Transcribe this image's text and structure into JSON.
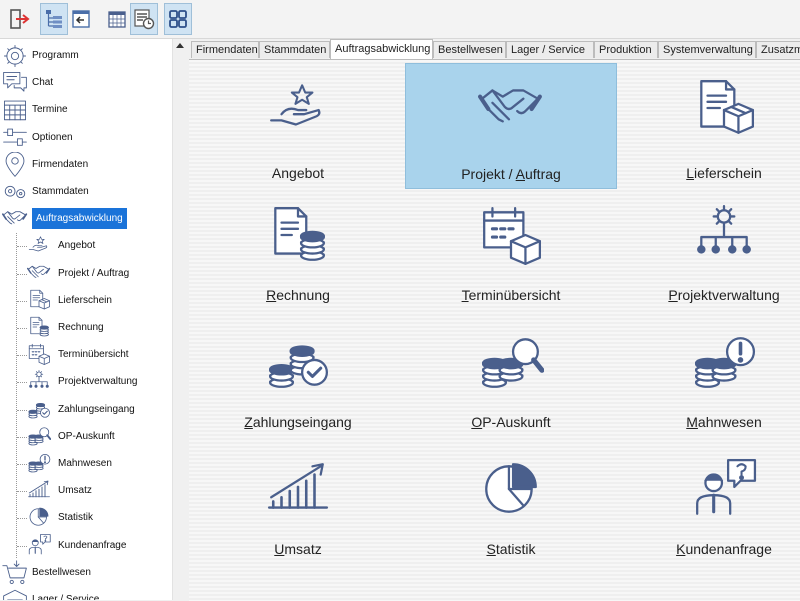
{
  "toolbar": {
    "buttons": [
      {
        "name": "logout-button",
        "icon": "exit-door-icon",
        "active": false
      },
      {
        "name": "tree-view-button",
        "icon": "tree-icon",
        "active": true
      },
      {
        "name": "back-panel-button",
        "icon": "panel-back-icon",
        "active": false
      },
      {
        "name": "calendar-button",
        "icon": "calendar-icon",
        "active": false
      },
      {
        "name": "calendar-clock-button",
        "icon": "calendar-clock-icon",
        "active": true
      },
      {
        "name": "grid-view-button",
        "icon": "grid-icon",
        "active": true
      }
    ]
  },
  "sidebar": {
    "items": [
      {
        "label": "Programm",
        "icon": "gear-badge-icon"
      },
      {
        "label": "Chat",
        "icon": "chat-icon"
      },
      {
        "label": "Termine",
        "icon": "calendar-icon"
      },
      {
        "label": "Optionen",
        "icon": "options-icon"
      },
      {
        "label": "Firmendaten",
        "icon": "location-pin-icon"
      },
      {
        "label": "Stammdaten",
        "icon": "gears-icon"
      },
      {
        "label": "Auftragsabwicklung",
        "icon": "handshake-icon",
        "selected": true
      },
      {
        "label": "Angebot",
        "icon": "hand-star-icon",
        "child": true
      },
      {
        "label": "Projekt / Auftrag",
        "icon": "handshake-icon",
        "child": true
      },
      {
        "label": "Lieferschein",
        "icon": "document-box-icon",
        "child": true
      },
      {
        "label": "Rechnung",
        "icon": "document-coins-icon",
        "child": true
      },
      {
        "label": "Terminübersicht",
        "icon": "calendar-box-icon",
        "child": true
      },
      {
        "label": "Projektverwaltung",
        "icon": "org-chart-gear-icon",
        "child": true
      },
      {
        "label": "Zahlungseingang",
        "icon": "coins-check-icon",
        "child": true
      },
      {
        "label": "OP-Auskunft",
        "icon": "coins-search-icon",
        "child": true
      },
      {
        "label": "Mahnwesen",
        "icon": "coins-alert-icon",
        "child": true
      },
      {
        "label": "Umsatz",
        "icon": "growth-chart-icon",
        "child": true
      },
      {
        "label": "Statistik",
        "icon": "pie-chart-icon",
        "child": true
      },
      {
        "label": "Kundenanfrage",
        "icon": "person-question-icon",
        "child": true
      },
      {
        "label": "Bestellwesen",
        "icon": "cart-icon"
      },
      {
        "label": "Lager / Service",
        "icon": "warehouse-icon"
      }
    ]
  },
  "tabs": [
    "Firmendaten",
    "Stammdaten",
    "Auftragsabwicklung",
    "Bestellwesen",
    "Lager / Service",
    "Produktion",
    "Systemverwaltung",
    "Zusatzmodu"
  ],
  "active_tab": "Auftragsabwicklung",
  "tiles": [
    {
      "pre": "",
      "u": "",
      "post": "Angebot",
      "icon": "hand-star-icon"
    },
    {
      "pre": "Projekt / ",
      "u": "A",
      "post": "uftrag",
      "icon": "handshake-icon",
      "selected": true
    },
    {
      "pre": "",
      "u": "L",
      "post": "ieferschein",
      "icon": "document-box-icon"
    },
    {
      "pre": "",
      "u": "R",
      "post": "echnung",
      "icon": "document-coins-icon"
    },
    {
      "pre": "",
      "u": "T",
      "post": "erminübersicht",
      "icon": "calendar-box-icon"
    },
    {
      "pre": "",
      "u": "P",
      "post": "rojektverwaltung",
      "icon": "org-chart-gear-icon"
    },
    {
      "pre": "",
      "u": "Z",
      "post": "ahlungseingang",
      "icon": "coins-check-icon"
    },
    {
      "pre": "",
      "u": "O",
      "post": "P-Auskunft",
      "icon": "coins-search-icon"
    },
    {
      "pre": "",
      "u": "M",
      "post": "ahnwesen",
      "icon": "coins-alert-icon"
    },
    {
      "pre": "",
      "u": "U",
      "post": "msatz",
      "icon": "growth-chart-icon"
    },
    {
      "pre": "",
      "u": "S",
      "post": "tatistik",
      "icon": "pie-chart-icon"
    },
    {
      "pre": "",
      "u": "K",
      "post": "undenanfrage",
      "icon": "person-question-icon"
    }
  ],
  "colors": {
    "accent": "#1a73d9",
    "icon_blue": "#4a5f8c",
    "selected_tile": "#a9d3ec",
    "active_tool": "#cfe3f3"
  }
}
